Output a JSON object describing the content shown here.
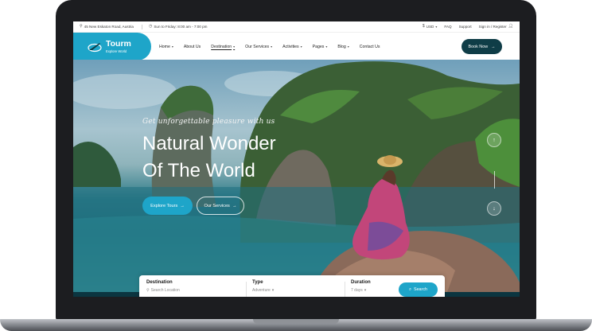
{
  "topbar": {
    "address": "45 New Eskaton Road, Austria",
    "hours": "Sun to Friday: 8:00 am - 7:00 pm",
    "currency": "USD",
    "faq": "FAQ",
    "support": "Support",
    "signin": "Sign in / Register"
  },
  "brand": {
    "name": "Tourm",
    "tagline": "Explore World",
    "color": "#1ea5c9",
    "dark": "#0f3d47"
  },
  "nav": {
    "items": [
      {
        "label": "Home",
        "dropdown": true
      },
      {
        "label": "About Us",
        "dropdown": false
      },
      {
        "label": "Destination",
        "dropdown": true,
        "active": true
      },
      {
        "label": "Our Services",
        "dropdown": true
      },
      {
        "label": "Activities",
        "dropdown": true
      },
      {
        "label": "Pages",
        "dropdown": true
      },
      {
        "label": "Blog",
        "dropdown": true
      },
      {
        "label": "Contact Us",
        "dropdown": false
      }
    ],
    "book_now": "Book Now"
  },
  "hero": {
    "subtitle": "Get unforgettable pleasure with us",
    "title_line1": "Natural Wonder",
    "title_line2": "Of The World",
    "explore_label": "Explore Tours",
    "services_label": "Our Services"
  },
  "search": {
    "destination_label": "Destination",
    "destination_placeholder": "Search Location",
    "type_label": "Type",
    "type_value": "Adventure",
    "duration_label": "Duration",
    "duration_value": "7 days",
    "button_label": "Search"
  },
  "icons": {
    "location": "map-pin-icon",
    "clock": "clock-icon",
    "user": "user-icon",
    "arrow": "arrow-right-icon"
  }
}
